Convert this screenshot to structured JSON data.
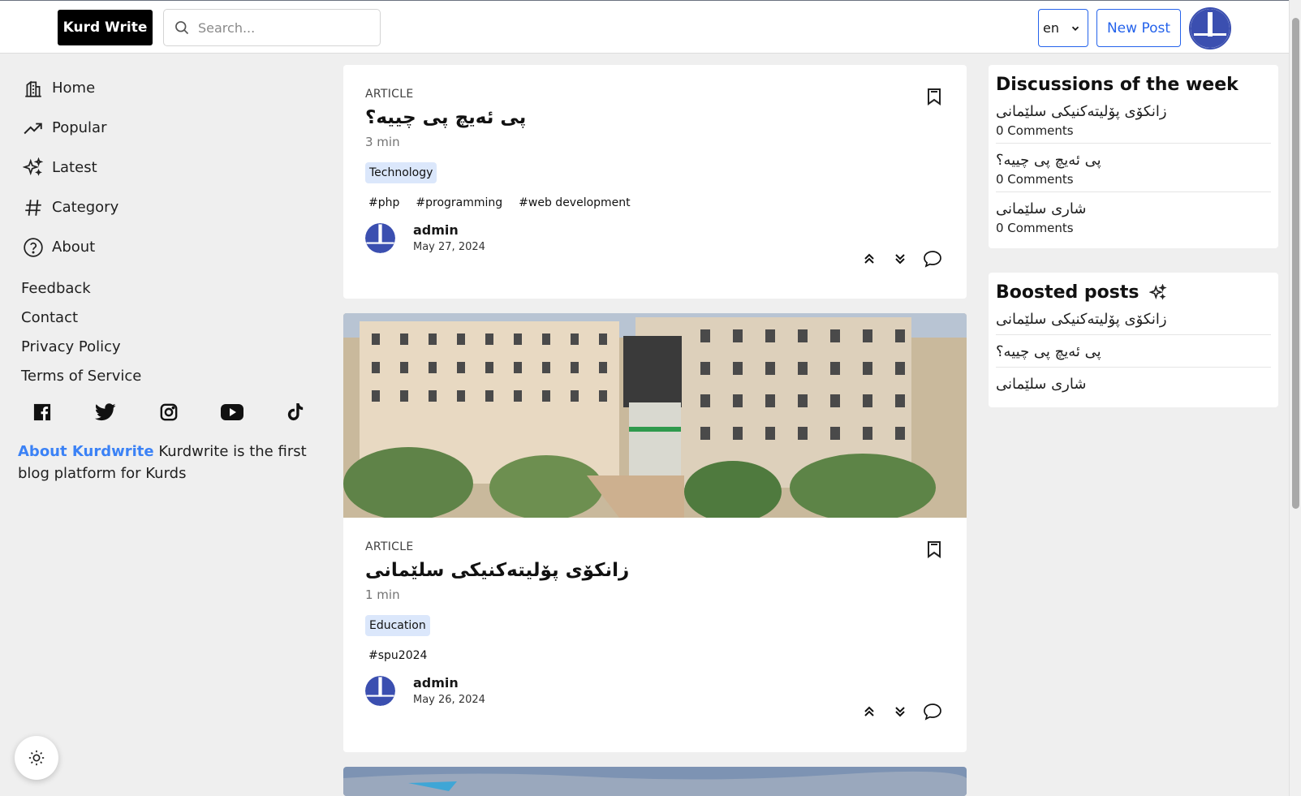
{
  "header": {
    "logo": "Kurd Write",
    "search_placeholder": "Search...",
    "language": "en",
    "new_post": "New Post"
  },
  "sidebar": {
    "nav": [
      {
        "label": "Home",
        "icon": "home-icon"
      },
      {
        "label": "Popular",
        "icon": "trending-icon"
      },
      {
        "label": "Latest",
        "icon": "sparkles-icon"
      },
      {
        "label": "Category",
        "icon": "hashtag-icon"
      },
      {
        "label": "About",
        "icon": "question-icon"
      }
    ],
    "links": [
      "Feedback",
      "Contact",
      "Privacy Policy",
      "Terms of Service"
    ],
    "social": [
      "facebook-icon",
      "twitter-icon",
      "instagram-icon",
      "youtube-icon",
      "tiktok-icon"
    ],
    "about_link": "About Kurdwrite",
    "about_text": "Kurdwrite is the first blog platform for Kurds"
  },
  "posts": [
    {
      "kind": "ARTICLE",
      "title": "پی ئەیچ پی چییە؟",
      "read_time": "3 min",
      "category": "Technology",
      "tags": [
        "#php",
        "#programming",
        "#web development"
      ],
      "author": "admin",
      "date": "May 27, 2024"
    },
    {
      "kind": "ARTICLE",
      "title": "زانکۆی پۆلیتەکنیکی سلێمانی",
      "read_time": "1 min",
      "category": "Education",
      "tags": [
        "#spu2024"
      ],
      "author": "admin",
      "date": "May 26, 2024"
    }
  ],
  "discussions": {
    "heading": "Discussions of the week",
    "items": [
      {
        "title": "زانکۆی پۆلیتەکنیکی سلێمانی",
        "comments": "0 Comments"
      },
      {
        "title": "پی ئەیچ پی چییە؟",
        "comments": "0 Comments"
      },
      {
        "title": "شاری سلێمانی",
        "comments": "0 Comments"
      }
    ]
  },
  "boosted": {
    "heading": "Boosted posts",
    "items": [
      "زانکۆی پۆلیتەکنیکی سلێمانی",
      "پی ئەیچ پی چییە؟",
      "شاری سلێمانی"
    ]
  },
  "colors": {
    "accent": "#2563eb",
    "avatar": "#3b4fb0",
    "category_bg": "#dbe7fb"
  }
}
